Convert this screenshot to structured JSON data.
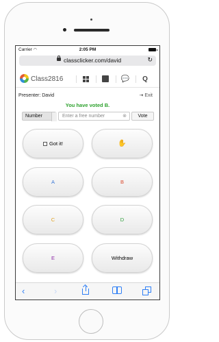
{
  "status_bar": {
    "carrier": "Carrier",
    "time": "2:05 PM"
  },
  "browser": {
    "url": "classclicker.com/david"
  },
  "app_nav": {
    "brand": "Class2816"
  },
  "session": {
    "presenter": "Presenter: David",
    "exit_label": "Exit",
    "message": "You have voted B."
  },
  "input_row": {
    "type_value": "Number",
    "placeholder": "Enter a free number",
    "vote_label": "Vote"
  },
  "buttons": [
    {
      "label": "Got it!",
      "color": "#222222"
    },
    {
      "label": "",
      "color": "#222222"
    },
    {
      "label": "A",
      "color": "#3a78d6"
    },
    {
      "label": "B",
      "color": "#d9482b"
    },
    {
      "label": "C",
      "color": "#e0a020"
    },
    {
      "label": "D",
      "color": "#2e9e3a"
    },
    {
      "label": "E",
      "color": "#8e2aa8"
    },
    {
      "label": "Withdraw",
      "color": "#222222"
    }
  ],
  "colors": {
    "accent": "#2f7ff6",
    "success": "#2da12d"
  }
}
